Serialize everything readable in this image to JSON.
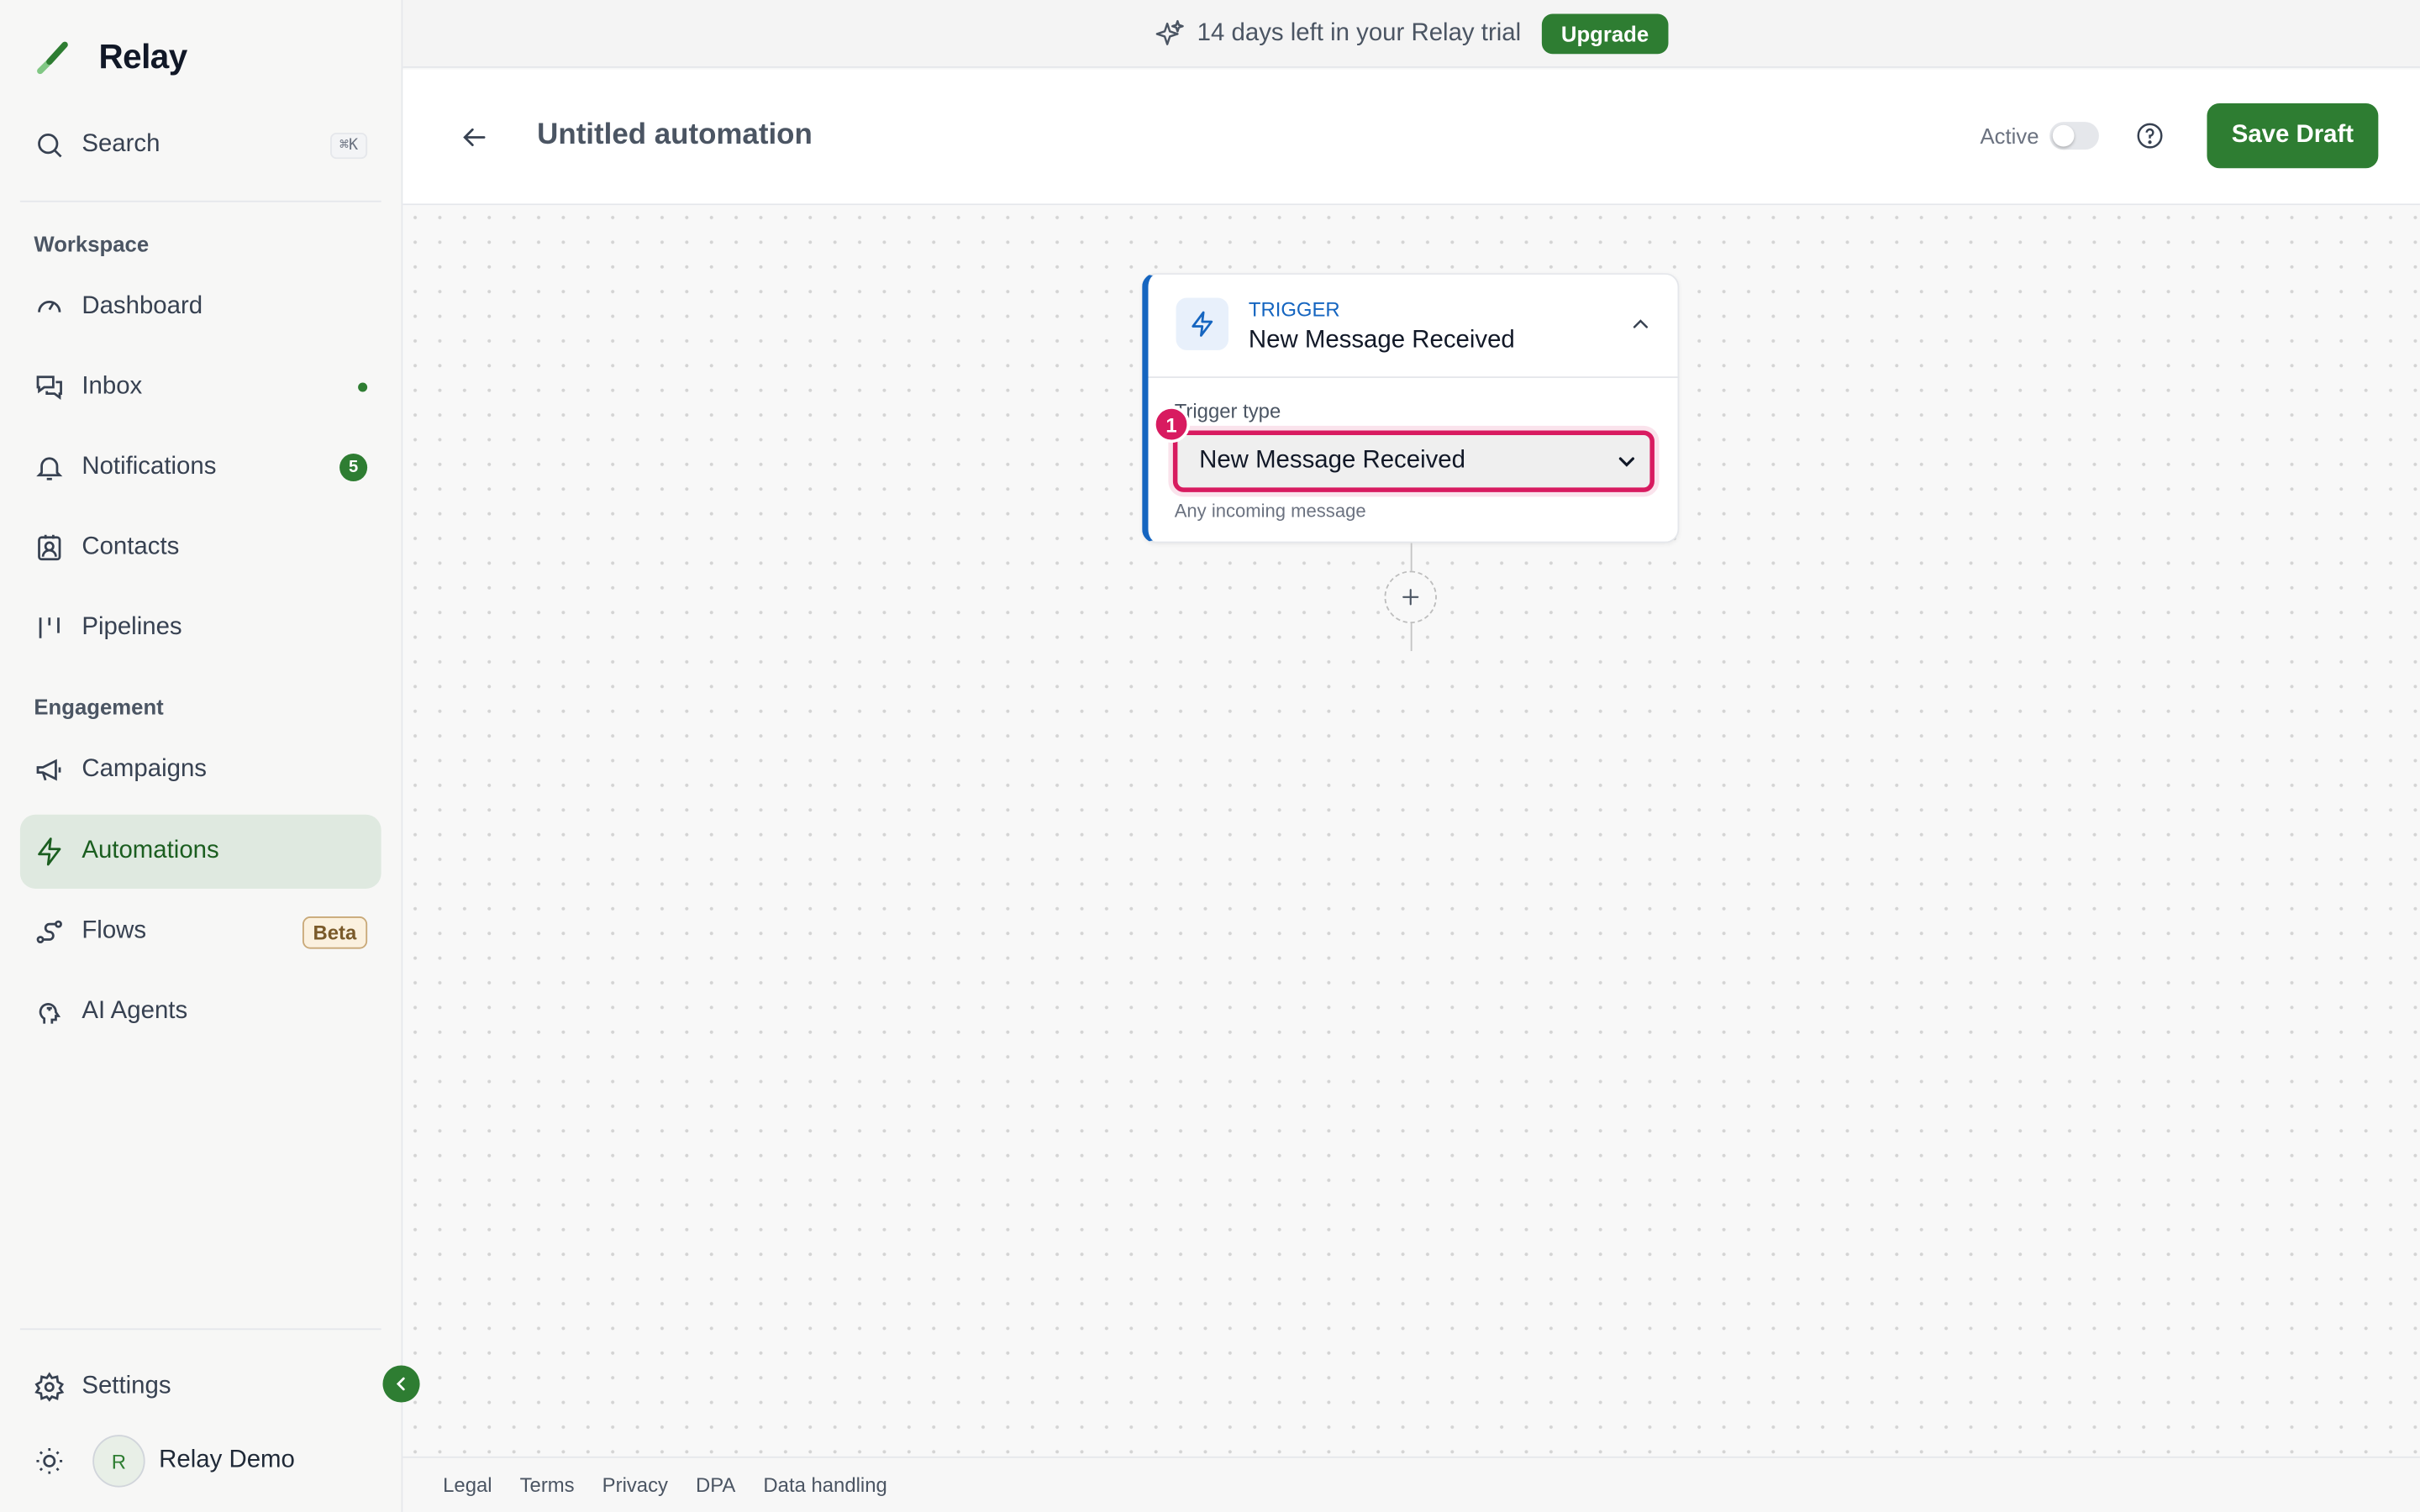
{
  "brand": {
    "name": "Relay"
  },
  "search": {
    "label": "Search",
    "shortcut": "⌘K"
  },
  "sidebar": {
    "workspace_label": "Workspace",
    "engagement_label": "Engagement",
    "items": [
      {
        "label": "Dashboard",
        "icon": "gauge-icon"
      },
      {
        "label": "Inbox",
        "icon": "inbox-icon",
        "dot": true
      },
      {
        "label": "Notifications",
        "icon": "bell-icon",
        "badge": "5"
      },
      {
        "label": "Contacts",
        "icon": "contact-card-icon"
      },
      {
        "label": "Pipelines",
        "icon": "pipelines-icon"
      },
      {
        "label": "Campaigns",
        "icon": "megaphone-icon"
      },
      {
        "label": "Automations",
        "icon": "bolt-icon",
        "active": true
      },
      {
        "label": "Flows",
        "icon": "flows-icon",
        "badge": "Beta"
      },
      {
        "label": "AI Agents",
        "icon": "agent-icon"
      }
    ],
    "settings_label": "Settings",
    "user": {
      "initial": "R",
      "name": "Relay Demo"
    }
  },
  "banner": {
    "text": "14 days left in your Relay trial",
    "cta": "Upgrade"
  },
  "header": {
    "title": "Untitled automation",
    "active_label": "Active",
    "active": false,
    "save_label": "Save Draft"
  },
  "trigger": {
    "kicker": "TRIGGER",
    "title": "New Message Received",
    "field_label": "Trigger type",
    "selected": "New Message Received",
    "hint": "Any incoming message",
    "marker": "1"
  },
  "footer": {
    "links": [
      "Legal",
      "Terms",
      "Privacy",
      "DPA",
      "Data handling"
    ]
  },
  "colors": {
    "accent": "#2e7d32",
    "trigger": "#1565c0",
    "highlight": "#d81b60"
  }
}
